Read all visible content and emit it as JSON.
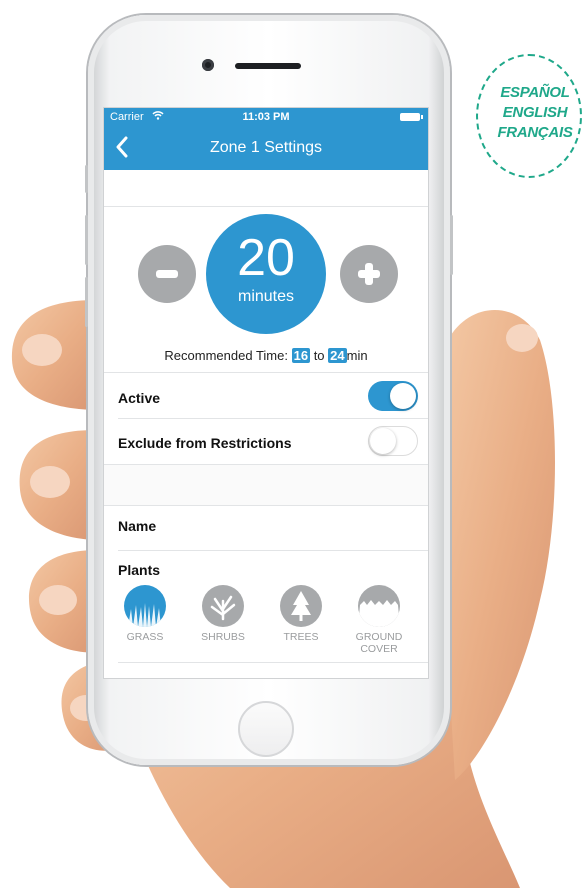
{
  "badge": {
    "languages": [
      "ESPAÑOL",
      "ENGLISH",
      "FRANÇAIS"
    ],
    "color": "#1fa88a"
  },
  "status_bar": {
    "carrier": "Carrier",
    "time": "11:03 PM"
  },
  "nav": {
    "back_icon": "chevron-left-icon",
    "title": "Zone 1 Settings"
  },
  "timer": {
    "value": "20",
    "unit": "minutes",
    "decrease_icon": "minus-icon",
    "increase_icon": "plus-icon"
  },
  "recommended": {
    "label": "Recommended Time:",
    "min": "16",
    "separator": "to",
    "max": "24",
    "unit": "min"
  },
  "settings": {
    "active": {
      "label": "Active",
      "on": true
    },
    "exclude": {
      "label": "Exclude from Restrictions",
      "on": false
    }
  },
  "name_row": {
    "label": "Name"
  },
  "plants": {
    "label": "Plants",
    "items": [
      {
        "label": "GRASS",
        "icon": "grass-icon",
        "selected": true
      },
      {
        "label": "SHRUBS",
        "icon": "shrubs-icon",
        "selected": false
      },
      {
        "label": "TREES",
        "icon": "trees-icon",
        "selected": false
      },
      {
        "label_line1": "GROUND",
        "label_line2": "COVER",
        "icon": "ground-cover-icon",
        "selected": false
      }
    ]
  },
  "colors": {
    "accent": "#2d96d0",
    "inactive_gray": "#a7a9ab"
  }
}
